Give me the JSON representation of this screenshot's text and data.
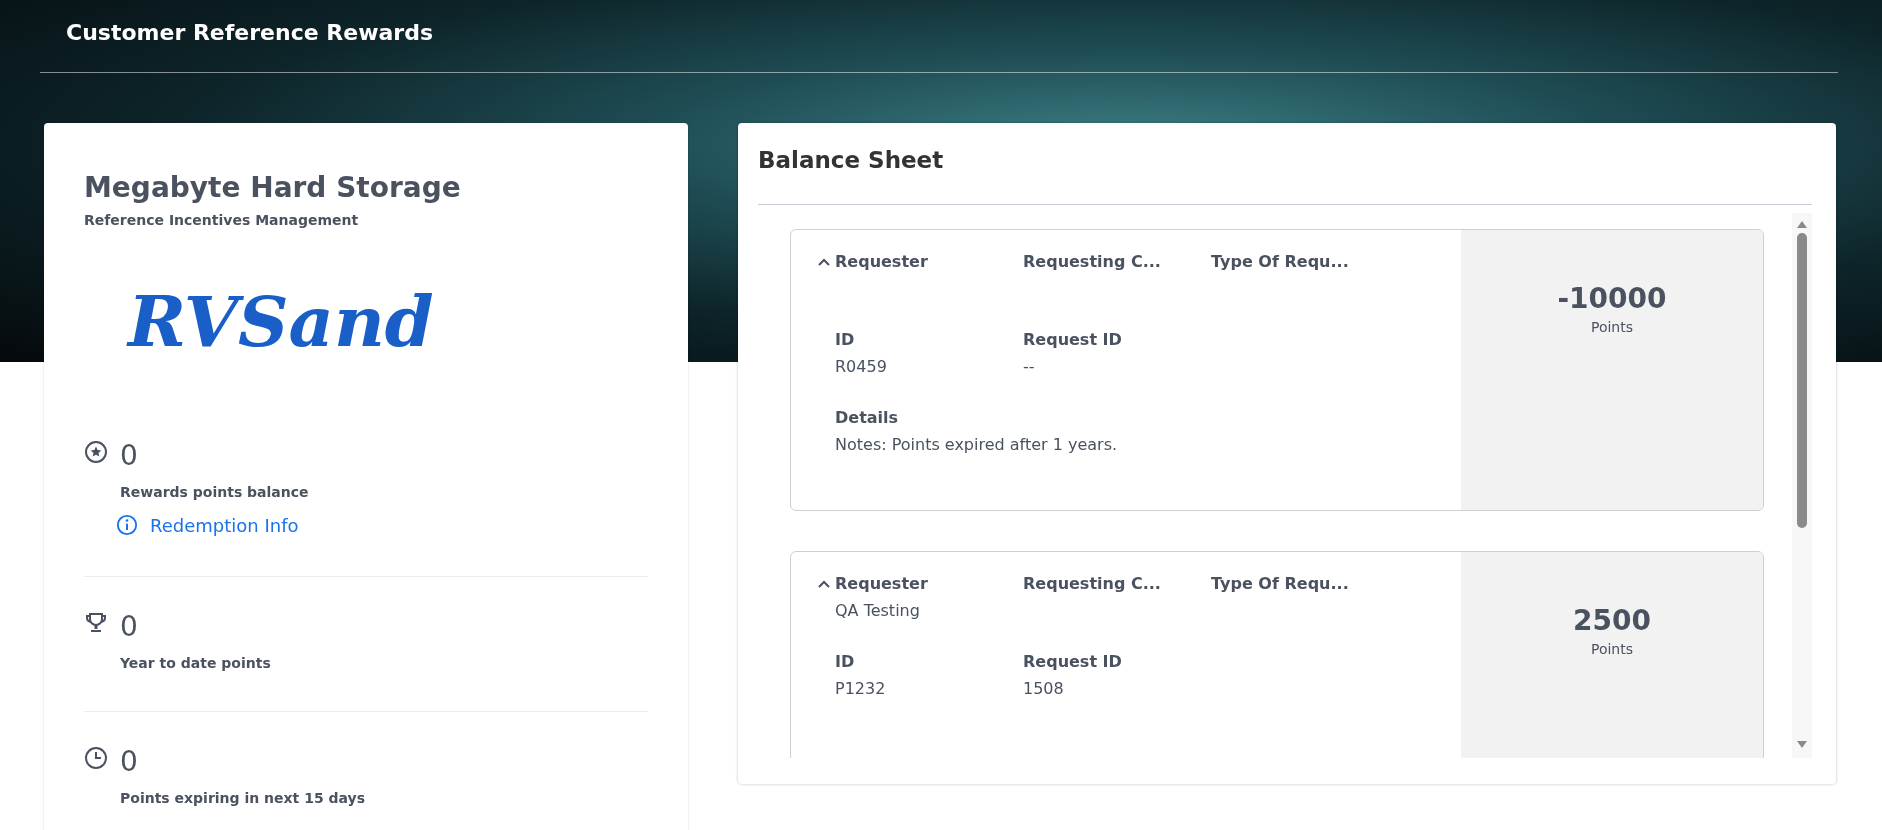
{
  "header": {
    "title": "Customer Reference Rewards"
  },
  "account": {
    "name": "Megabyte Hard Storage",
    "subtitle": "Reference Incentives Management",
    "logo": "RVSand",
    "stats": [
      {
        "kind": "star",
        "value": "0",
        "label": "Rewards points balance",
        "link": "Redemption Info"
      },
      {
        "kind": "trophy",
        "value": "0",
        "label": "Year to date points"
      },
      {
        "kind": "clock",
        "value": "0",
        "label": "Points expiring in next 15 days"
      }
    ]
  },
  "balance_sheet": {
    "title": "Balance Sheet",
    "entries": [
      {
        "expanded": true,
        "points": "-10000",
        "points_label": "Points",
        "rows": [
          [
            {
              "label": "Requester"
            },
            {
              "label": "Requesting C..."
            },
            {
              "label": "Type Of Requ..."
            }
          ],
          [
            {
              "label": "ID",
              "value": "R0459"
            },
            {
              "label": "Request ID",
              "value": "--"
            }
          ],
          [
            {
              "label": "Details",
              "value": "Notes: Points expired after 1 years."
            }
          ]
        ]
      },
      {
        "expanded": true,
        "points": "2500",
        "points_label": "Points",
        "rows": [
          [
            {
              "label": "Requester",
              "value": "QA Testing"
            },
            {
              "label": "Requesting C..."
            },
            {
              "label": "Type Of Requ..."
            }
          ],
          [
            {
              "label": "ID",
              "value": "P1232"
            },
            {
              "label": "Request ID",
              "value": "1508"
            }
          ]
        ]
      }
    ]
  }
}
